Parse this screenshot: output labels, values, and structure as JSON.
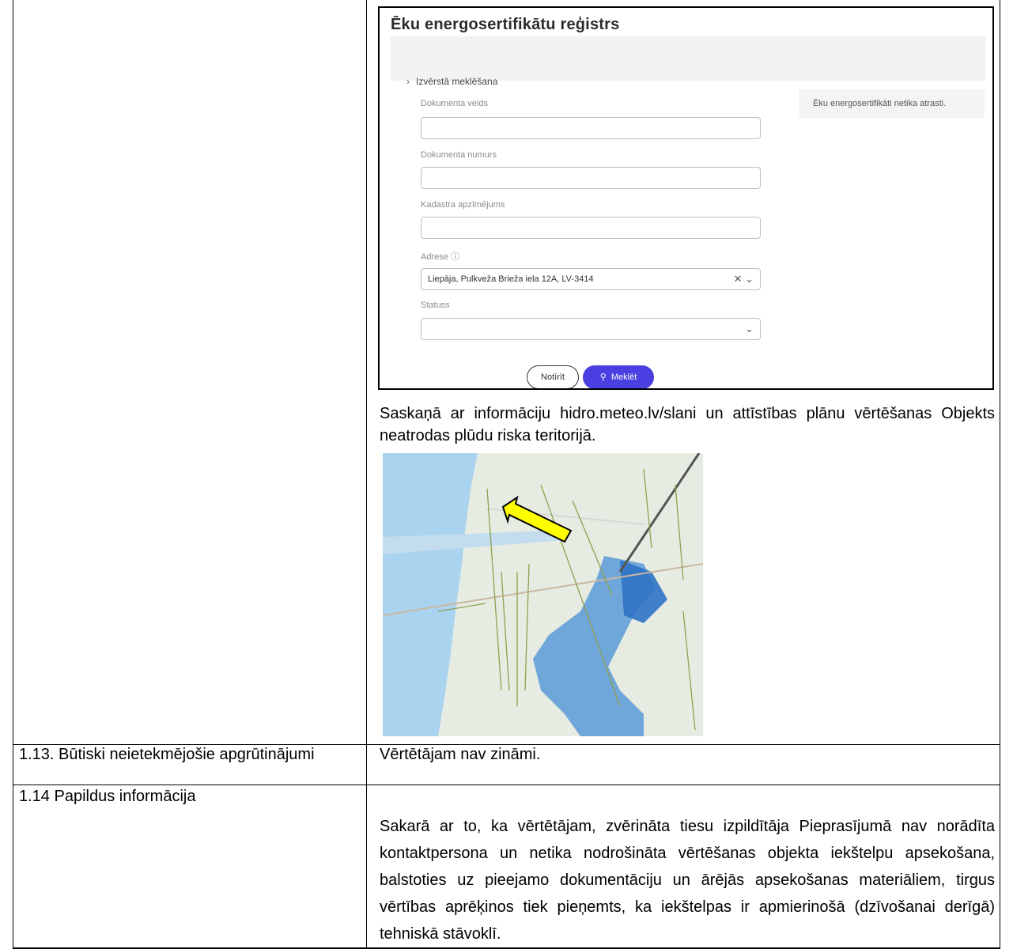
{
  "registry": {
    "title": "Ēku energosertifikātu reģistrs",
    "advanced_search": "Izvērstā meklēšana",
    "fields": [
      {
        "label": "Dokumenta veids",
        "value": ""
      },
      {
        "label": "Dokumenta numurs",
        "value": ""
      },
      {
        "label": "Kadastra apzīmējums",
        "value": ""
      },
      {
        "label": "Adrese ⓘ",
        "value": "Liepāja, Pulkveža Brieža iela 12A, LV-3414"
      },
      {
        "label": "Statuss",
        "value": ""
      }
    ],
    "no_results": "Ēku energosertifikāti netika atrasti.",
    "clear_button": "Notīrīt",
    "search_button": "Meklēt"
  },
  "flood_text": "Saskaņā ar informāciju hidro.meteo.lv/slani un attīstības plānu vērtēšanas Objekts neatrodas plūdu riska teritorijā.",
  "rows": [
    {
      "label": "1.13. Būtiski neietekmējošie apgrūtinājumi",
      "value": "Vērtētājam nav zināmi."
    },
    {
      "label": "1.14 Papildus informācija",
      "value": "Sakarā ar to, ka vērtētājam, zvērināta tiesu izpildītāja Pieprasījumā nav norādīta kontaktpersona un netika nodrošināta vērtēšanas objekta iekštelpu apsekošana, balstoties uz pieejamo dokumentāciju un ārējās apsekošanas materiāliem, tirgus vērtības aprēķinos tiek pieņemts, ka iekštelpas ir apmierinošā (dzīvošanai derīgā) tehniskā stāvoklī."
    }
  ]
}
